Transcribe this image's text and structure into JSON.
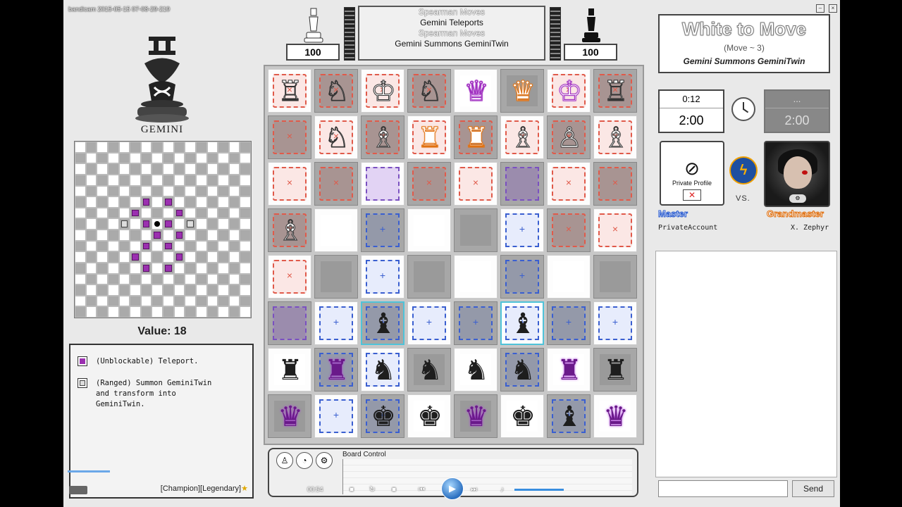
{
  "recording": {
    "watermark": "bandicam 2015-05-15 07-08-29-219"
  },
  "piece_info": {
    "name": "GEMINI",
    "value_label": "Value: 18",
    "legend": [
      {
        "icon": "teleport-marker-icon",
        "color": "#9b30b0",
        "text": "(Unblockable) Teleport."
      },
      {
        "icon": "summon-marker-icon",
        "color": "#444444",
        "text": "(Ranged) Summon GeminiTwin\nand transform into\nGeminiTwin."
      }
    ],
    "rank_label": "[Champion][Legendary]",
    "rank_star": "★"
  },
  "move_grid": {
    "size": 16,
    "teleport": [
      [
        6,
        5
      ],
      [
        6,
        9
      ],
      [
        8,
        7
      ],
      [
        8,
        9
      ],
      [
        10,
        5
      ],
      [
        10,
        9
      ],
      [
        9,
        6
      ],
      [
        9,
        8
      ],
      [
        7,
        6
      ],
      [
        7,
        8
      ],
      [
        11,
        6
      ],
      [
        11,
        8
      ],
      [
        5,
        6
      ],
      [
        5,
        8
      ]
    ],
    "summon": [
      [
        7,
        4
      ],
      [
        7,
        10
      ]
    ],
    "origin": [
      7,
      7
    ]
  },
  "scores": {
    "white": "100",
    "black": "100"
  },
  "move_log": [
    {
      "text": "Spearman Moves",
      "faded": true
    },
    {
      "text": "Gemini Teleports",
      "faded": false
    },
    {
      "text": "Spearman Moves",
      "faded": true
    },
    {
      "text": "Gemini Summons GeminiTwin",
      "faded": false
    }
  ],
  "board": {
    "rows": [
      [
        {
          "p": "♖",
          "c": "w",
          "h": "red"
        },
        {
          "p": "♘",
          "c": "w",
          "h": "red"
        },
        {
          "p": "♔",
          "c": "w",
          "h": "red"
        },
        {
          "p": "♘",
          "c": "w",
          "h": "red"
        },
        {
          "p": "♕",
          "c": "wp",
          "h": ""
        },
        {
          "p": "♛",
          "c": "wo",
          "h": ""
        },
        {
          "p": "♔",
          "c": "wp",
          "h": "red"
        },
        {
          "p": "♖",
          "c": "w",
          "h": "red"
        }
      ],
      [
        {
          "p": "",
          "c": "",
          "h": "red"
        },
        {
          "p": "♘",
          "c": "w",
          "h": "red"
        },
        {
          "p": "♗",
          "c": "w",
          "h": "red"
        },
        {
          "p": "♜",
          "c": "wo",
          "h": "red"
        },
        {
          "p": "♜",
          "c": "wo",
          "h": "red"
        },
        {
          "p": "♗",
          "c": "w",
          "h": "red"
        },
        {
          "p": "♙",
          "c": "w",
          "h": "red"
        },
        {
          "p": "♗",
          "c": "w",
          "h": "red"
        }
      ],
      [
        {
          "p": "",
          "c": "",
          "h": "red"
        },
        {
          "p": "",
          "c": "",
          "h": "red"
        },
        {
          "p": "",
          "c": "",
          "h": "purple"
        },
        {
          "p": "",
          "c": "",
          "h": "red"
        },
        {
          "p": "",
          "c": "",
          "h": "red"
        },
        {
          "p": "",
          "c": "",
          "h": "purple"
        },
        {
          "p": "",
          "c": "",
          "h": "red"
        },
        {
          "p": "",
          "c": "",
          "h": "red"
        }
      ],
      [
        {
          "p": "♗",
          "c": "w",
          "h": "red"
        },
        {
          "p": "",
          "c": "",
          "h": ""
        },
        {
          "p": "",
          "c": "",
          "h": "blue"
        },
        {
          "p": "",
          "c": "",
          "h": ""
        },
        {
          "p": "",
          "c": "",
          "h": ""
        },
        {
          "p": "",
          "c": "",
          "h": "blue"
        },
        {
          "p": "",
          "c": "",
          "h": "red"
        },
        {
          "p": "",
          "c": "",
          "h": "red"
        }
      ],
      [
        {
          "p": "",
          "c": "",
          "h": "red"
        },
        {
          "p": "",
          "c": "",
          "h": ""
        },
        {
          "p": "",
          "c": "",
          "h": "blue"
        },
        {
          "p": "",
          "c": "",
          "h": ""
        },
        {
          "p": "",
          "c": "",
          "h": ""
        },
        {
          "p": "",
          "c": "",
          "h": "blue"
        },
        {
          "p": "",
          "c": "",
          "h": ""
        },
        {
          "p": "",
          "c": "",
          "h": ""
        }
      ],
      [
        {
          "p": "",
          "c": "",
          "h": "purple"
        },
        {
          "p": "",
          "c": "",
          "h": "blue"
        },
        {
          "p": "♝",
          "c": "b",
          "h": "blue",
          "sel": true
        },
        {
          "p": "",
          "c": "",
          "h": "blue"
        },
        {
          "p": "",
          "c": "",
          "h": "blue"
        },
        {
          "p": "♝",
          "c": "b",
          "h": "blue",
          "sel": true
        },
        {
          "p": "",
          "c": "",
          "h": "blue"
        },
        {
          "p": "",
          "c": "",
          "h": "blue"
        }
      ],
      [
        {
          "p": "♜",
          "c": "b",
          "h": ""
        },
        {
          "p": "♜",
          "c": "bp",
          "h": "blue"
        },
        {
          "p": "♞",
          "c": "b",
          "h": "blue"
        },
        {
          "p": "♞",
          "c": "b",
          "h": ""
        },
        {
          "p": "♞",
          "c": "b",
          "h": ""
        },
        {
          "p": "♞",
          "c": "b",
          "h": "blue"
        },
        {
          "p": "♜",
          "c": "bp",
          "h": ""
        },
        {
          "p": "♜",
          "c": "b",
          "h": ""
        }
      ],
      [
        {
          "p": "♛",
          "c": "bp",
          "h": ""
        },
        {
          "p": "",
          "c": "",
          "h": "blue"
        },
        {
          "p": "♚",
          "c": "b",
          "h": "blue"
        },
        {
          "p": "♚",
          "c": "b",
          "h": ""
        },
        {
          "p": "♛",
          "c": "bp",
          "h": ""
        },
        {
          "p": "♚",
          "c": "b",
          "h": ""
        },
        {
          "p": "♝",
          "c": "b",
          "h": "blue"
        },
        {
          "p": "♛",
          "c": "bp",
          "h": ""
        }
      ]
    ]
  },
  "board_control": {
    "title": "Board Control"
  },
  "turn": {
    "title": "White to Move",
    "move_number": "(Move ~ 3)",
    "last_move": "Gemini Summons GeminiTwin"
  },
  "clocks": {
    "white": {
      "increment": "0:12",
      "total": "2:00"
    },
    "black": {
      "increment": "...",
      "total": "2:00"
    }
  },
  "players": {
    "white": {
      "profile_label": "Private Profile",
      "rank": "Master",
      "rank_color": "#2a5cd0",
      "name": "PrivateAccount"
    },
    "black": {
      "rank": "Grandmaster",
      "rank_color": "#e07010",
      "name": "X. Zephyr"
    },
    "vs_label": "VS."
  },
  "chat": {
    "send_label": "Send"
  },
  "player": {
    "time": "00:54"
  }
}
